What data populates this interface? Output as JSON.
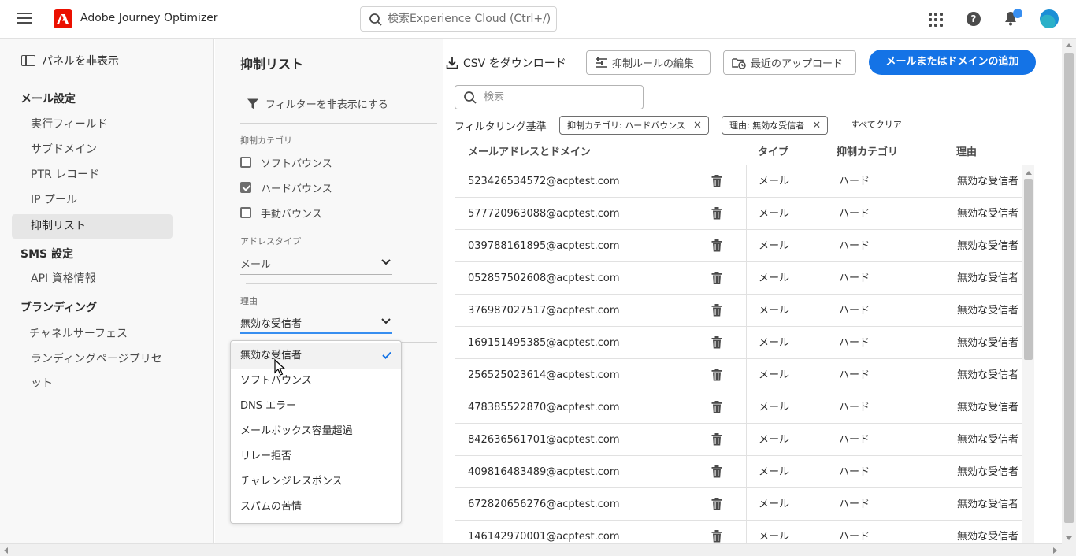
{
  "header": {
    "app_title": "Adobe Journey Optimizer",
    "search_placeholder": "検索Experience Cloud (Ctrl+/)",
    "icons": [
      "hamburger-menu-icon",
      "adobe-logo-icon",
      "search-icon",
      "apps-grid-icon",
      "help-icon",
      "notifications-bell-icon",
      "user-avatar"
    ]
  },
  "leftnav": {
    "hide_panel": "パネルを非表示",
    "sections": [
      {
        "title": "メール設定",
        "items": [
          "実行フィールド",
          "サブドメイン",
          "PTR レコード",
          "IP プール",
          "抑制リスト"
        ]
      },
      {
        "title": "SMS 設定",
        "items": [
          "API 資格情報"
        ]
      },
      {
        "title": "ブランディング",
        "items": [
          "チャネルサーフェス",
          "ランディングページプリセット"
        ]
      }
    ],
    "active_item": "抑制リスト"
  },
  "filters": {
    "page_title": "抑制リスト",
    "hide_filters": "フィルターを非表示にする",
    "category_label": "抑制カテゴリ",
    "categories": [
      {
        "label": "ソフトバウンス",
        "checked": false
      },
      {
        "label": "ハードバウンス",
        "checked": true
      },
      {
        "label": "手動バウンス",
        "checked": false
      }
    ],
    "address_type_label": "アドレスタイプ",
    "address_type_value": "メール",
    "reason_label": "理由",
    "reason_value": "無効な受信者"
  },
  "reason_dropdown": {
    "options": [
      "無効な受信者",
      "ソフトバウンス",
      "DNS エラー",
      "メールボックス容量超過",
      "リレー拒否",
      "チャレンジレスポンス",
      "スパムの苦情"
    ],
    "selected": "無効な受信者"
  },
  "toolbar": {
    "download_csv": "CSV をダウンロード",
    "edit_rules": "抑制ルールの編集",
    "recent_uploads": "最近のアップロード",
    "add_button": "メールまたはドメインの追加"
  },
  "search": {
    "placeholder": "検索"
  },
  "active_filters": {
    "label": "フィルタリング基準",
    "tags": [
      "抑制カテゴリ: ハードバウンス",
      "理由: 無効な受信者"
    ],
    "clear_all": "すべてクリア"
  },
  "table": {
    "columns": [
      "メールアドレスとドメイン",
      "タイプ",
      "抑制カテゴリ",
      "理由"
    ],
    "rows": [
      {
        "email": "523426534572@acptest.com",
        "type": "メール",
        "category": "ハード",
        "reason": "無効な受信者"
      },
      {
        "email": "577720963088@acptest.com",
        "type": "メール",
        "category": "ハード",
        "reason": "無効な受信者"
      },
      {
        "email": "039788161895@acptest.com",
        "type": "メール",
        "category": "ハード",
        "reason": "無効な受信者"
      },
      {
        "email": "052857502608@acptest.com",
        "type": "メール",
        "category": "ハード",
        "reason": "無効な受信者"
      },
      {
        "email": "376987027517@acptest.com",
        "type": "メール",
        "category": "ハード",
        "reason": "無効な受信者"
      },
      {
        "email": "169151495385@acptest.com",
        "type": "メール",
        "category": "ハード",
        "reason": "無効な受信者"
      },
      {
        "email": "256525023614@acptest.com",
        "type": "メール",
        "category": "ハード",
        "reason": "無効な受信者"
      },
      {
        "email": "478385522870@acptest.com",
        "type": "メール",
        "category": "ハード",
        "reason": "無効な受信者"
      },
      {
        "email": "842636561701@acptest.com",
        "type": "メール",
        "category": "ハード",
        "reason": "無効な受信者"
      },
      {
        "email": "409816483489@acptest.com",
        "type": "メール",
        "category": "ハード",
        "reason": "無効な受信者"
      },
      {
        "email": "672820656276@acptest.com",
        "type": "メール",
        "category": "ハード",
        "reason": "無効な受信者"
      },
      {
        "email": "146142970001@acptest.com",
        "type": "メール",
        "category": "ハード",
        "reason": "無効な受信者"
      }
    ]
  },
  "colors": {
    "accent": "#1473e6",
    "adobe_red": "#eb1000",
    "notification_dot": "#378ef0",
    "panel_bg": "#f8f8f8"
  }
}
